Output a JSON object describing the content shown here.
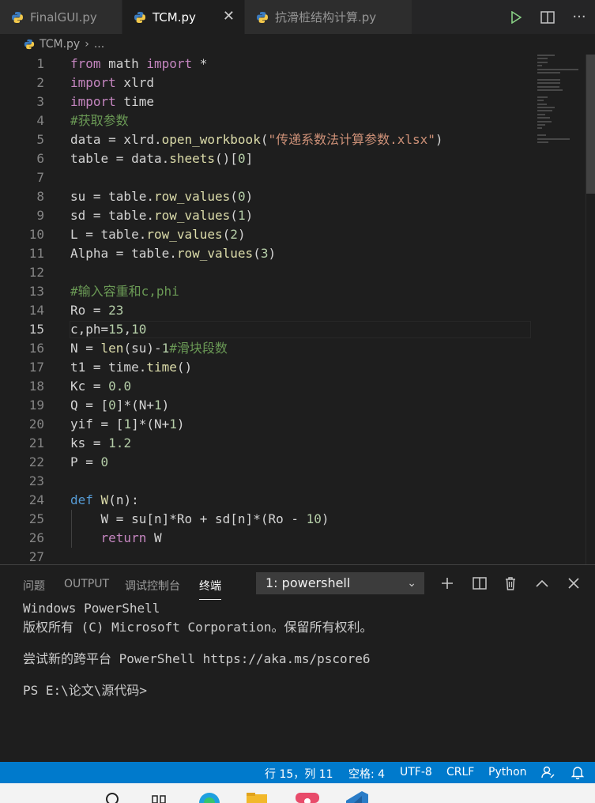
{
  "tabs": [
    {
      "label": "FinalGUI.py",
      "active": false
    },
    {
      "label": "TCM.py",
      "active": true
    },
    {
      "label": "抗滑桩结构计算.py",
      "active": false
    }
  ],
  "tab_close_icon": "close-icon",
  "actions": {
    "run": "run-icon",
    "split": "split-editor-icon",
    "more": "···"
  },
  "breadcrumb": {
    "file": "TCM.py",
    "sep": "›",
    "more": "..."
  },
  "editor": {
    "current_line": 15,
    "lines": [
      {
        "n": "1",
        "tokens": [
          [
            "kw",
            "from"
          ],
          [
            "var",
            " math "
          ],
          [
            "kw",
            "import"
          ],
          [
            "var",
            " *"
          ]
        ]
      },
      {
        "n": "2",
        "tokens": [
          [
            "kw",
            "import"
          ],
          [
            "var",
            " xlrd"
          ]
        ]
      },
      {
        "n": "3",
        "tokens": [
          [
            "kw",
            "import"
          ],
          [
            "var",
            " time"
          ]
        ]
      },
      {
        "n": "4",
        "tokens": [
          [
            "cm",
            "#获取参数"
          ]
        ]
      },
      {
        "n": "5",
        "tokens": [
          [
            "var",
            "data = xlrd."
          ],
          [
            "fn",
            "open_workbook"
          ],
          [
            "var",
            "("
          ],
          [
            "str",
            "\"传递系数法计算参数.xlsx\""
          ],
          [
            "var",
            ")"
          ]
        ]
      },
      {
        "n": "6",
        "tokens": [
          [
            "var",
            "table = data."
          ],
          [
            "fn",
            "sheets"
          ],
          [
            "var",
            "()["
          ],
          [
            "num",
            "0"
          ],
          [
            "var",
            "]"
          ]
        ]
      },
      {
        "n": "7",
        "tokens": []
      },
      {
        "n": "8",
        "tokens": [
          [
            "var",
            "su = table."
          ],
          [
            "fn",
            "row_values"
          ],
          [
            "var",
            "("
          ],
          [
            "num",
            "0"
          ],
          [
            "var",
            ")"
          ]
        ]
      },
      {
        "n": "9",
        "tokens": [
          [
            "var",
            "sd = table."
          ],
          [
            "fn",
            "row_values"
          ],
          [
            "var",
            "("
          ],
          [
            "num",
            "1"
          ],
          [
            "var",
            ")"
          ]
        ]
      },
      {
        "n": "10",
        "tokens": [
          [
            "var",
            "L = table."
          ],
          [
            "fn",
            "row_values"
          ],
          [
            "var",
            "("
          ],
          [
            "num",
            "2"
          ],
          [
            "var",
            ")"
          ]
        ]
      },
      {
        "n": "11",
        "tokens": [
          [
            "var",
            "Alpha = table."
          ],
          [
            "fn",
            "row_values"
          ],
          [
            "var",
            "("
          ],
          [
            "num",
            "3"
          ],
          [
            "var",
            ")"
          ]
        ]
      },
      {
        "n": "12",
        "tokens": []
      },
      {
        "n": "13",
        "tokens": [
          [
            "cm",
            "#输入容重和c,phi"
          ]
        ]
      },
      {
        "n": "14",
        "tokens": [
          [
            "var",
            "Ro = "
          ],
          [
            "num",
            "23"
          ]
        ]
      },
      {
        "n": "15",
        "tokens": [
          [
            "var",
            "c,ph="
          ],
          [
            "num",
            "15"
          ],
          [
            "var",
            ","
          ],
          [
            "num",
            "10"
          ]
        ]
      },
      {
        "n": "16",
        "tokens": [
          [
            "var",
            "N = "
          ],
          [
            "fn",
            "len"
          ],
          [
            "var",
            "(su)-"
          ],
          [
            "num",
            "1"
          ],
          [
            "cm",
            "#滑块段数"
          ]
        ]
      },
      {
        "n": "17",
        "tokens": [
          [
            "var",
            "t1 = time."
          ],
          [
            "fn",
            "time"
          ],
          [
            "var",
            "()"
          ]
        ]
      },
      {
        "n": "18",
        "tokens": [
          [
            "var",
            "Kc = "
          ],
          [
            "num",
            "0.0"
          ]
        ]
      },
      {
        "n": "19",
        "tokens": [
          [
            "var",
            "Q = ["
          ],
          [
            "num",
            "0"
          ],
          [
            "var",
            "]*(N+"
          ],
          [
            "num",
            "1"
          ],
          [
            "var",
            ")"
          ]
        ]
      },
      {
        "n": "20",
        "tokens": [
          [
            "var",
            "yif = ["
          ],
          [
            "num",
            "1"
          ],
          [
            "var",
            "]*(N+"
          ],
          [
            "num",
            "1"
          ],
          [
            "var",
            ")"
          ]
        ]
      },
      {
        "n": "21",
        "tokens": [
          [
            "var",
            "ks = "
          ],
          [
            "num",
            "1.2"
          ]
        ]
      },
      {
        "n": "22",
        "tokens": [
          [
            "var",
            "P = "
          ],
          [
            "num",
            "0"
          ]
        ]
      },
      {
        "n": "23",
        "tokens": []
      },
      {
        "n": "24",
        "tokens": [
          [
            "def",
            "def"
          ],
          [
            "var",
            " "
          ],
          [
            "fn",
            "W"
          ],
          [
            "var",
            "(n):"
          ]
        ]
      },
      {
        "n": "25",
        "tokens": [
          [
            "var",
            "    W = su[n]*Ro + sd[n]*(Ro - "
          ],
          [
            "num",
            "10"
          ],
          [
            "var",
            ")"
          ]
        ]
      },
      {
        "n": "26",
        "tokens": [
          [
            "var",
            "    "
          ],
          [
            "kw",
            "return"
          ],
          [
            "var",
            " W"
          ]
        ]
      },
      {
        "n": "27",
        "tokens": []
      }
    ]
  },
  "panel": {
    "tabs": [
      "问题",
      "OUTPUT",
      "调试控制台",
      "终端"
    ],
    "active_tab": "终端",
    "terminal_select": "1: powershell",
    "icons": [
      "plus-icon",
      "split-terminal-icon",
      "trash-icon",
      "chevron-up-icon",
      "close-icon"
    ],
    "terminal_lines": [
      "Windows PowerShell",
      "版权所有 (C) Microsoft Corporation。保留所有权利。",
      "",
      "尝试新的跨平台 PowerShell https://aka.ms/pscore6",
      "",
      "PS E:\\论文\\源代码>"
    ]
  },
  "status": {
    "position": "行 15，列 11",
    "spaces": "空格: 4",
    "encoding": "UTF-8",
    "eol": "CRLF",
    "language": "Python"
  },
  "colors": {
    "statusbar": "#007acc",
    "editor_bg": "#1e1e1e",
    "tabbar_bg": "#252526"
  }
}
